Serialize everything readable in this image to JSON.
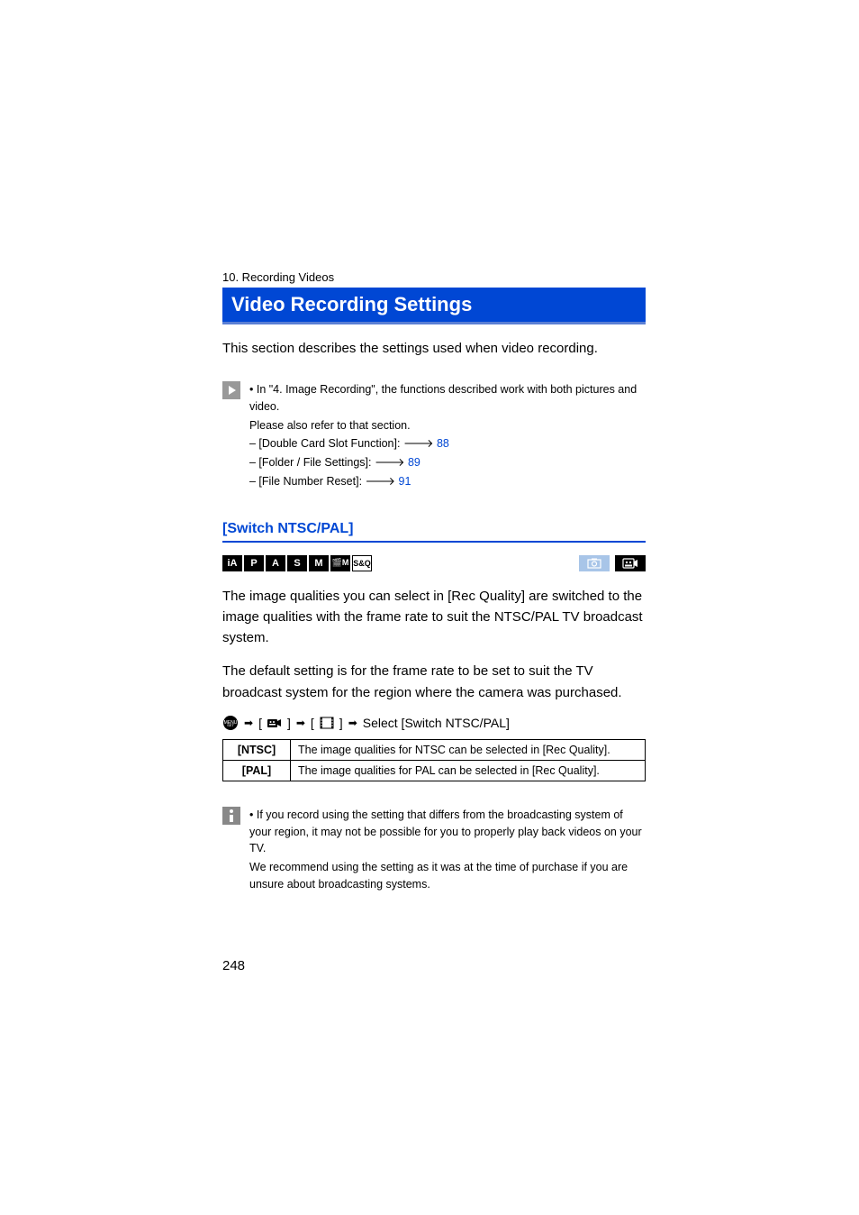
{
  "chapter": "10. Recording Videos",
  "title": "Video Recording Settings",
  "intro": "This section describes the settings used when video recording.",
  "note1": {
    "bullet": "• In \"4. Image Recording\", the functions described work with both pictures and video.",
    "refer": "Please also refer to that section.",
    "items": [
      {
        "text": "– [Double Card Slot Function]: ",
        "link": "88"
      },
      {
        "text": "– [Folder / File Settings]: ",
        "link": "89"
      },
      {
        "text": "– [File Number Reset]: ",
        "link": "91"
      }
    ]
  },
  "subheading": "[Switch NTSC/PAL]",
  "modes": [
    "iA",
    "P",
    "A",
    "S",
    "M"
  ],
  "modes_outline": [
    "🎬M",
    "S&Q"
  ],
  "body1": "The image qualities you can select in [Rec Quality] are switched to the image qualities with the frame rate to suit the NTSC/PAL TV broadcast system.",
  "body2": "The default setting is for the frame rate to be set to suit the TV broadcast system for the region where the camera was purchased.",
  "menu_select": "Select [Switch NTSC/PAL]",
  "table": [
    {
      "key": "[NTSC]",
      "desc": "The image qualities for NTSC can be selected in [Rec Quality]."
    },
    {
      "key": "[PAL]",
      "desc": "The image qualities for PAL can be selected in [Rec Quality]."
    }
  ],
  "note2": {
    "bullet": "• If you record using the setting that differs from the broadcasting system of your region, it may not be possible for you to properly play back videos on your TV.",
    "recommend": "We recommend using the setting as it was at the time of purchase if you are unsure about broadcasting systems."
  },
  "page_num": "248"
}
